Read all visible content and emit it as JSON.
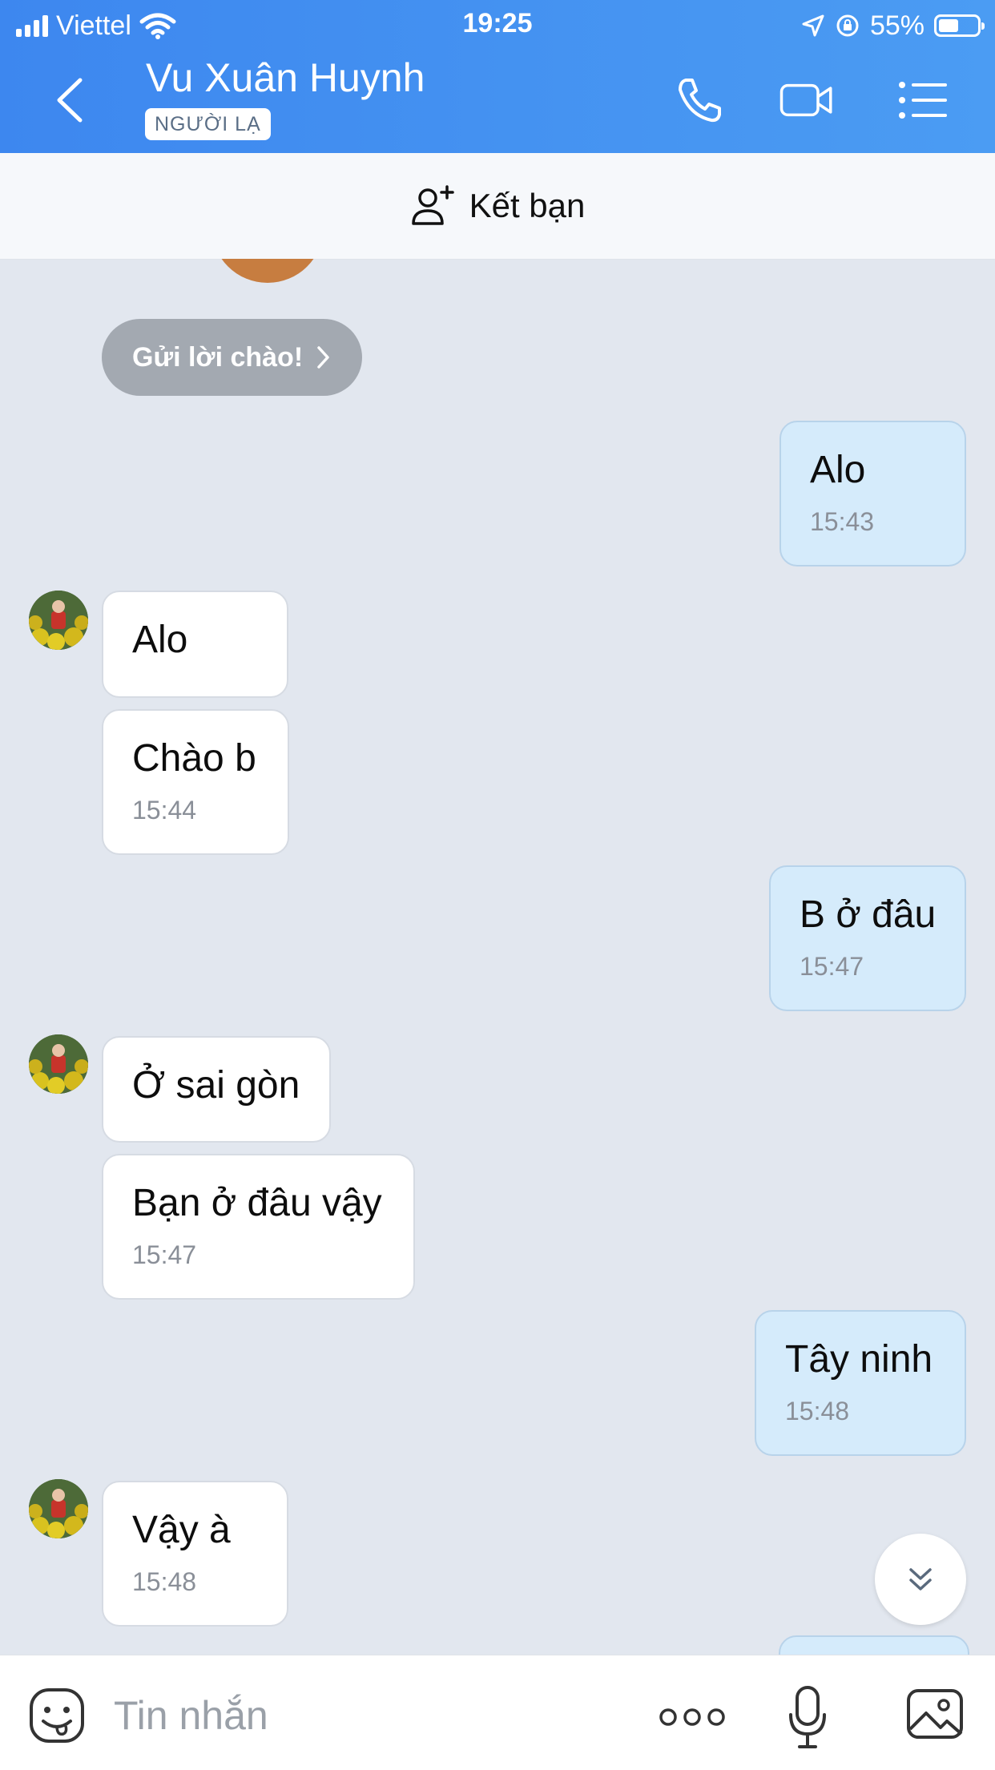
{
  "status_bar": {
    "carrier": "Viettel",
    "time": "19:25",
    "battery_percent": "55%",
    "battery_level": 0.55
  },
  "header": {
    "contact_name": "Vu Xuân Huynh",
    "badge": "NGƯỜI LẠ",
    "icons": [
      "back-icon",
      "phone-icon",
      "video-call-icon",
      "menu-list-icon"
    ]
  },
  "add_friend": {
    "label": "Kết bạn"
  },
  "chat": {
    "greeting_label": "Gửi lời chào!",
    "messages": [
      {
        "sender": "me",
        "text": "Alo",
        "time": "15:43"
      },
      {
        "sender": "other",
        "text": "Alo",
        "time": ""
      },
      {
        "sender": "other",
        "text": "Chào b",
        "time": "15:44"
      },
      {
        "sender": "me",
        "text": "B ở đâu",
        "time": "15:47"
      },
      {
        "sender": "other",
        "text": "Ở sai gòn",
        "time": ""
      },
      {
        "sender": "other",
        "text": "Bạn ở đâu vậy",
        "time": "15:47"
      },
      {
        "sender": "me",
        "text": "Tây ninh",
        "time": "15:48"
      },
      {
        "sender": "other",
        "text": "Vậy à",
        "time": "15:48"
      }
    ]
  },
  "composer": {
    "placeholder": "Tin nhắn",
    "icons": [
      "sticker-icon",
      "more-dots-icon",
      "microphone-icon",
      "image-icon"
    ]
  },
  "colors": {
    "header_gradient_start": "#3d87ef",
    "header_gradient_end": "#4b9cf3",
    "my_bubble": "#d5ebfb",
    "chat_background": "#e2e7ef"
  }
}
